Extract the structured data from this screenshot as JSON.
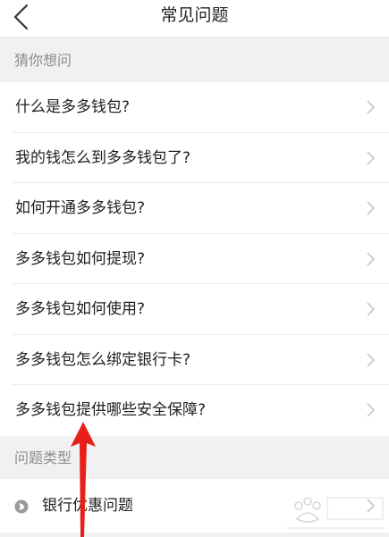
{
  "header": {
    "title": "常见问题",
    "back_icon": "chevron-left-icon"
  },
  "sections": {
    "guess": {
      "label": "猜你想问"
    },
    "types": {
      "label": "问题类型"
    }
  },
  "faq_items": [
    {
      "label": "什么是多多钱包?"
    },
    {
      "label": "我的钱怎么到多多钱包了?"
    },
    {
      "label": "如何开通多多钱包?"
    },
    {
      "label": "多多钱包如何提现?"
    },
    {
      "label": "多多钱包如何使用?"
    },
    {
      "label": "多多钱包怎么绑定银行卡?"
    },
    {
      "label": "多多钱包提供哪些安全保障?"
    }
  ],
  "type_items": [
    {
      "label": "银行优惠问题",
      "icon": "coin-icon"
    }
  ],
  "annotation": {
    "color": "#e8201a",
    "target": "多多钱包提供哪些安全保障?"
  },
  "colors": {
    "background": "#f1f1f3",
    "surface": "#ffffff",
    "text": "#1f1f1f",
    "section_text": "#8c8c8c",
    "chevron": "#c7c7c7"
  }
}
